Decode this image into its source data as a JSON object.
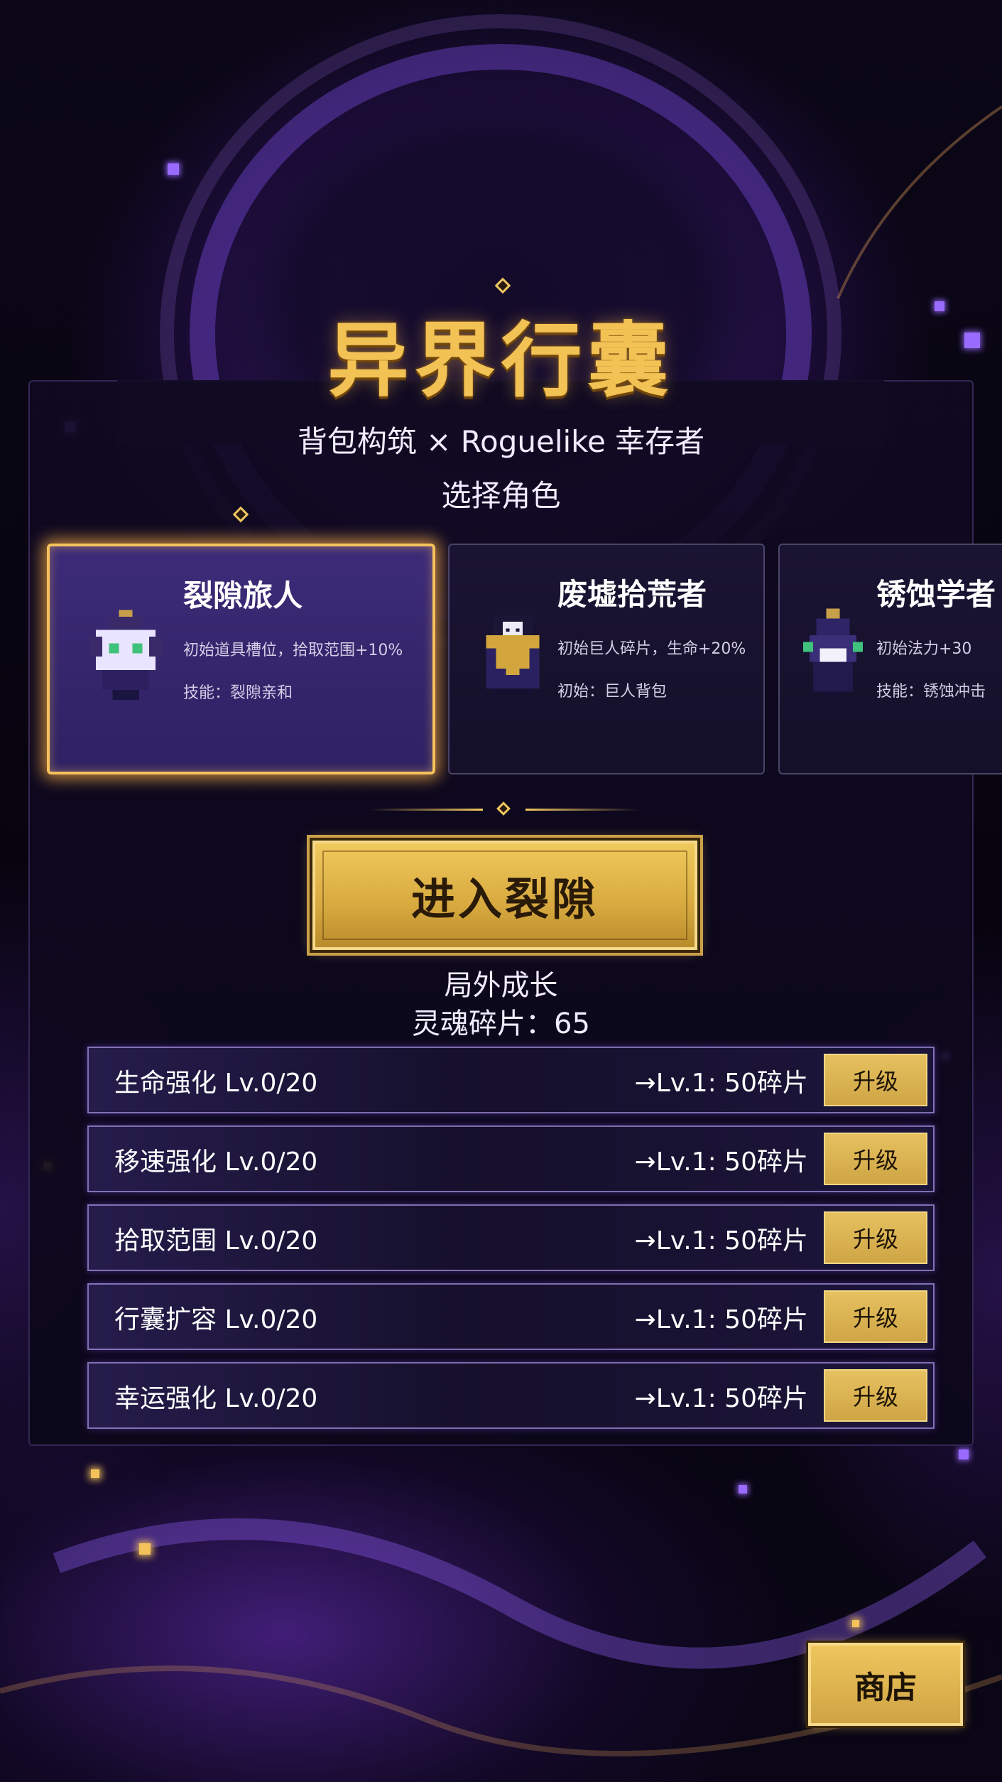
{
  "title": "异界行囊",
  "subtitle": "背包构筑 × Roguelike 幸存者",
  "select_label": "选择角色",
  "characters": [
    {
      "name": "裂隙旅人",
      "desc": "初始道具槽位，拾取范围+10%",
      "skill": "技能：裂隙亲和",
      "selected": true
    },
    {
      "name": "废墟拾荒者",
      "desc": "初始巨人碎片，生命+20%",
      "skill": "初始：巨人背包",
      "selected": false
    },
    {
      "name": "锈蚀学者",
      "desc": "初始法力+30",
      "skill": "技能：锈蚀冲击",
      "selected": false
    }
  ],
  "enter_button": "进入裂隙",
  "meta": {
    "title": "局外成长",
    "shards": "灵魂碎片：65"
  },
  "upgrades": [
    {
      "name": "生命强化 Lv.0/20",
      "cost": "→Lv.1: 50碎片",
      "button": "升级"
    },
    {
      "name": "移速强化 Lv.0/20",
      "cost": "→Lv.1: 50碎片",
      "button": "升级"
    },
    {
      "name": "拾取范围 Lv.0/20",
      "cost": "→Lv.1: 50碎片",
      "button": "升级"
    },
    {
      "name": "行囊扩容 Lv.0/20",
      "cost": "→Lv.1: 50碎片",
      "button": "升级"
    },
    {
      "name": "幸运强化 Lv.0/20",
      "cost": "→Lv.1: 50碎片",
      "button": "升级"
    }
  ],
  "shop_button": "商店",
  "colors": {
    "gold": "#f2c255",
    "panel": "#120c26",
    "accent_purple": "#9a6bff"
  }
}
